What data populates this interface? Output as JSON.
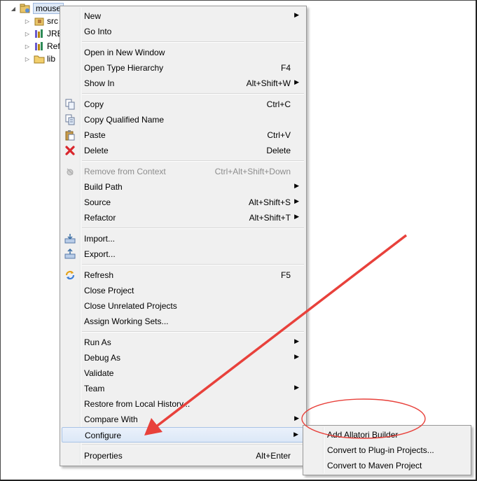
{
  "tree": {
    "root": "mouse",
    "children": [
      {
        "label": "src",
        "icon": "package-folder-icon"
      },
      {
        "label": "JRE",
        "icon": "library-icon"
      },
      {
        "label": "Ref",
        "icon": "library-icon"
      },
      {
        "label": "lib",
        "icon": "folder-icon"
      }
    ]
  },
  "menu": {
    "items": [
      {
        "label": "New",
        "shortcut": "",
        "submenu": true
      },
      {
        "label": "Go Into",
        "shortcut": "",
        "submenu": false
      },
      {
        "label": "Open in New Window",
        "shortcut": "",
        "submenu": false
      },
      {
        "label": "Open Type Hierarchy",
        "shortcut": "F4",
        "submenu": false
      },
      {
        "label": "Show In",
        "shortcut": "Alt+Shift+W",
        "submenu": true
      },
      {
        "label": "Copy",
        "shortcut": "Ctrl+C",
        "submenu": false,
        "icon": "copy-icon"
      },
      {
        "label": "Copy Qualified Name",
        "shortcut": "",
        "submenu": false,
        "icon": "copy-qualified-name-icon"
      },
      {
        "label": "Paste",
        "shortcut": "Ctrl+V",
        "submenu": false,
        "icon": "paste-icon"
      },
      {
        "label": "Delete",
        "shortcut": "Delete",
        "submenu": false,
        "icon": "delete-icon"
      },
      {
        "label": "Remove from Context",
        "shortcut": "Ctrl+Alt+Shift+Down",
        "submenu": false,
        "disabled": true,
        "icon": "remove-from-context-icon"
      },
      {
        "label": "Build Path",
        "shortcut": "",
        "submenu": true
      },
      {
        "label": "Source",
        "shortcut": "Alt+Shift+S",
        "submenu": true
      },
      {
        "label": "Refactor",
        "shortcut": "Alt+Shift+T",
        "submenu": true
      },
      {
        "label": "Import...",
        "shortcut": "",
        "submenu": false,
        "icon": "import-icon"
      },
      {
        "label": "Export...",
        "shortcut": "",
        "submenu": false,
        "icon": "export-icon"
      },
      {
        "label": "Refresh",
        "shortcut": "F5",
        "submenu": false,
        "icon": "refresh-icon"
      },
      {
        "label": "Close Project",
        "shortcut": "",
        "submenu": false
      },
      {
        "label": "Close Unrelated Projects",
        "shortcut": "",
        "submenu": false
      },
      {
        "label": "Assign Working Sets...",
        "shortcut": "",
        "submenu": false
      },
      {
        "label": "Run As",
        "shortcut": "",
        "submenu": true
      },
      {
        "label": "Debug As",
        "shortcut": "",
        "submenu": true
      },
      {
        "label": "Validate",
        "shortcut": "",
        "submenu": false
      },
      {
        "label": "Team",
        "shortcut": "",
        "submenu": true
      },
      {
        "label": "Restore from Local History...",
        "shortcut": "",
        "submenu": false
      },
      {
        "label": "Compare With",
        "shortcut": "",
        "submenu": true
      },
      {
        "label": "Configure",
        "shortcut": "",
        "submenu": true,
        "highlighted": true
      },
      {
        "label": "Properties",
        "shortcut": "Alt+Enter",
        "submenu": false
      }
    ]
  },
  "submenu": {
    "items": [
      {
        "label": "Add Allatori Builder"
      },
      {
        "label": "Convert to Plug-in Projects..."
      },
      {
        "label": "Convert to Maven Project"
      }
    ]
  },
  "annotation": {
    "color": "#e8413b"
  }
}
